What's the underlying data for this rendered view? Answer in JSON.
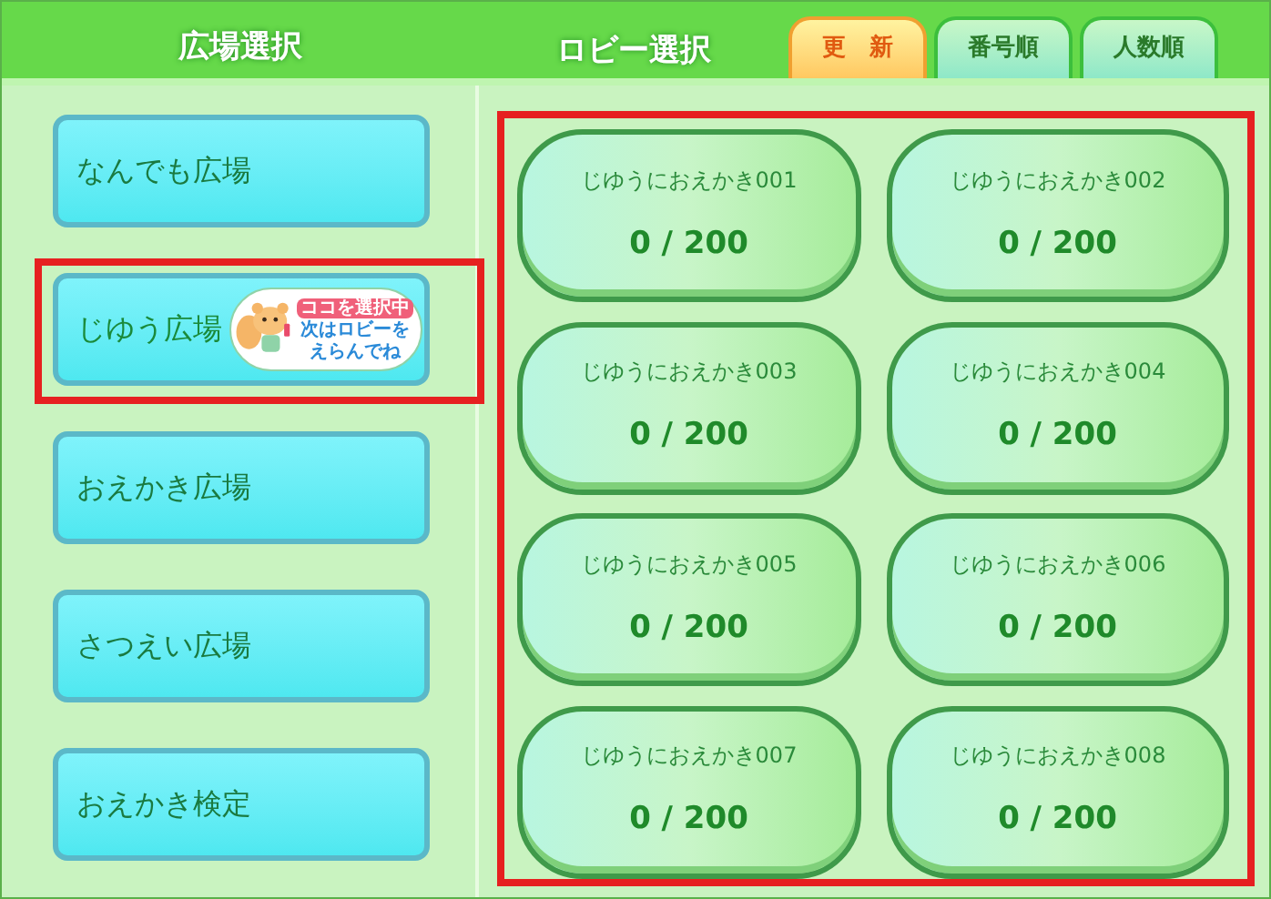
{
  "headers": {
    "plaza": "広場選択",
    "lobby": "ロビー選択"
  },
  "tabs": [
    {
      "label": "更　新",
      "selected": true
    },
    {
      "label": "番号順",
      "selected": false
    },
    {
      "label": "人数順",
      "selected": false
    }
  ],
  "plazas": [
    {
      "label": "なんでも広場",
      "selected": false
    },
    {
      "label": "じゆう広場",
      "selected": true
    },
    {
      "label": "おえかき広場",
      "selected": false
    },
    {
      "label": "さつえい広場",
      "selected": false
    },
    {
      "label": "おえかき検定",
      "selected": false
    }
  ],
  "selection_badge": {
    "title": "ココを選択中",
    "lines": [
      "次はロビーを",
      "えらんでね"
    ]
  },
  "lobbies": [
    {
      "name": "じゆうにおえかき001",
      "count": "0 / 200"
    },
    {
      "name": "じゆうにおえかき002",
      "count": "0 / 200"
    },
    {
      "name": "じゆうにおえかき003",
      "count": "0 / 200"
    },
    {
      "name": "じゆうにおえかき004",
      "count": "0 / 200"
    },
    {
      "name": "じゆうにおえかき005",
      "count": "0 / 200"
    },
    {
      "name": "じゆうにおえかき006",
      "count": "0 / 200"
    },
    {
      "name": "じゆうにおえかき007",
      "count": "0 / 200"
    },
    {
      "name": "じゆうにおえかき008",
      "count": "0 / 200"
    }
  ],
  "lobby_area_highlighted": true
}
